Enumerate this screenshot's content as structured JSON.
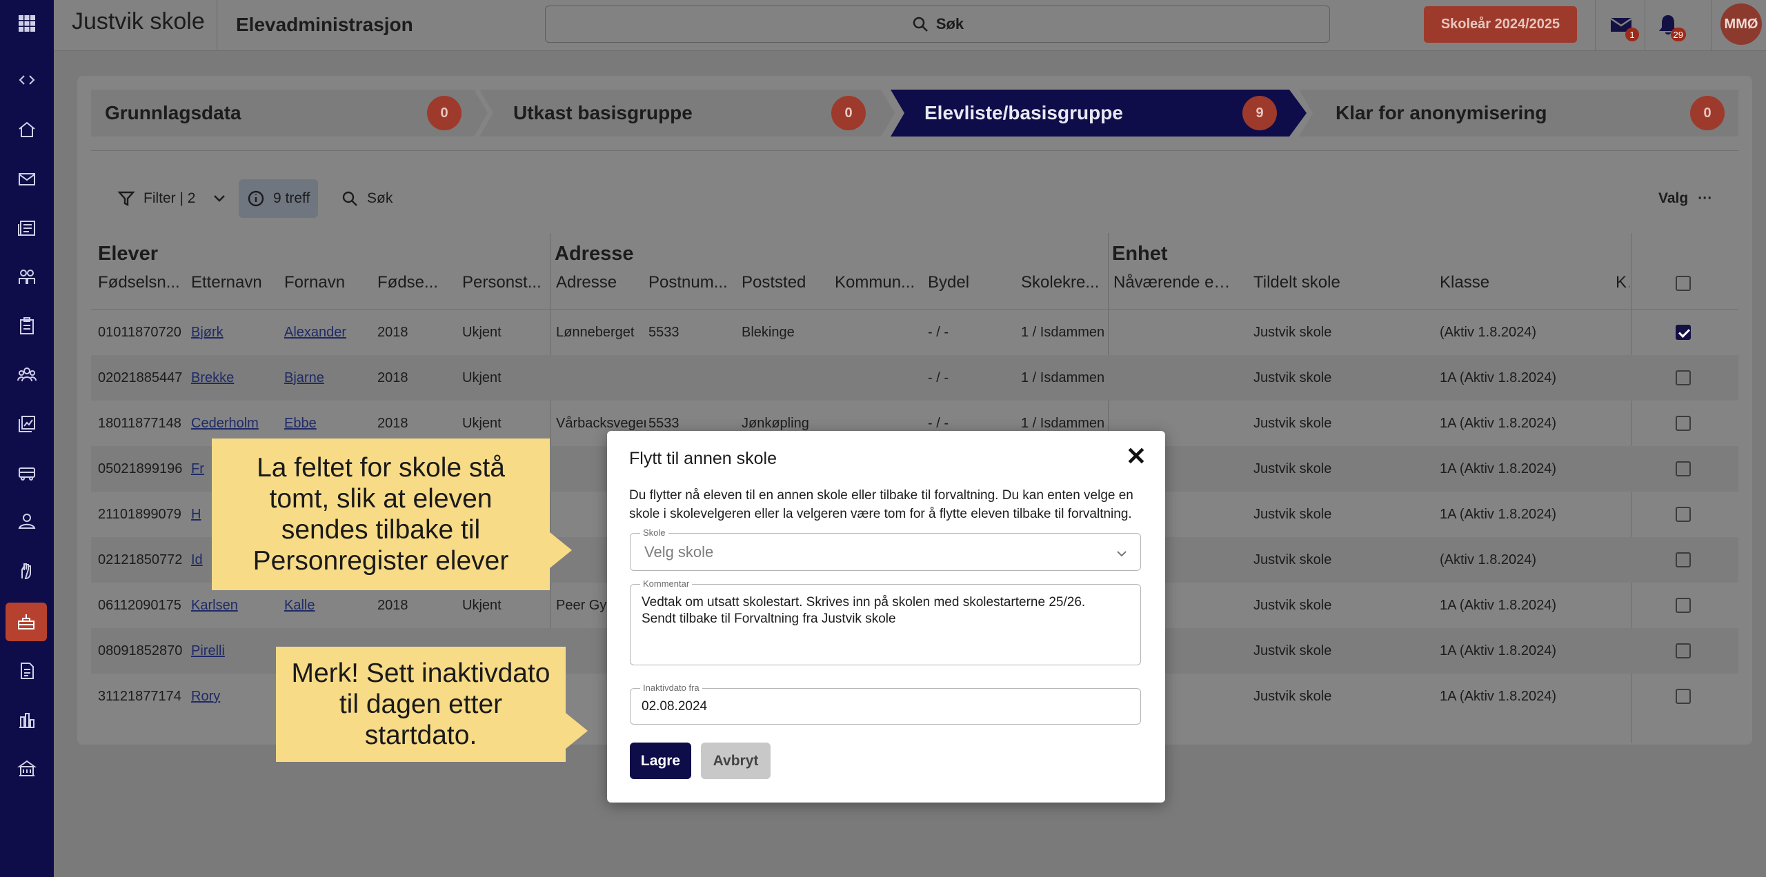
{
  "topbar": {
    "school_name": "Justvik skole",
    "app_title": "Elevadministrasjon",
    "search_label": "Søk",
    "year_button": "Skoleår 2024/2025",
    "mail_badge": "1",
    "bell_badge": "29",
    "avatar_initials": "MMØ"
  },
  "rail": {
    "items": [
      "grid-icon",
      "expand-icon",
      "home-icon",
      "mail-icon",
      "newspaper-icon",
      "people-icon",
      "clipboard-icon",
      "group-icon",
      "chart-card-icon",
      "vehicle-icon",
      "person-icon",
      "hand-icon",
      "school-icon",
      "document-icon",
      "bar-chart-icon",
      "building-icon"
    ],
    "active_color": "#b6412f"
  },
  "stepper": {
    "steps": [
      {
        "label": "Grunnlagsdata",
        "count": "0"
      },
      {
        "label": "Utkast basisgruppe",
        "count": "0"
      },
      {
        "label": "Elevliste/basisgruppe",
        "count": "9"
      },
      {
        "label": "Klar for anonymisering",
        "count": "0"
      }
    ],
    "active_step": 2,
    "active_color": "#0f0c4a"
  },
  "toolbar": {
    "filter_label": "Filter | 2",
    "hits_label": "9 treff",
    "search_label": "Søk",
    "options_label": "Valg",
    "more_label": "···"
  },
  "table": {
    "groups": [
      "Elever",
      "Adresse",
      "Enhet"
    ],
    "headers": [
      "Fødselsn...",
      "Etternavn",
      "Fornavn",
      "Fødse...",
      "Personst...",
      "Adresse",
      "Postnum...",
      "Poststed",
      "Kommun...",
      "Bydel",
      "Skolekre...",
      "Nåværende en...",
      "Tildelt skole",
      "Klasse",
      "Ko"
    ],
    "rows": [
      {
        "fnr": "01011870720",
        "etternavn": "Bjørk",
        "fornavn": "Alexander",
        "aar": "2018",
        "status": "Ukjent",
        "adresse": "Lønneberget",
        "postnr": "5533",
        "poststed": "Blekinge",
        "kommune": "",
        "bydel": "- / -",
        "krets": "1 / Isdammen",
        "naavaerende": "",
        "tildelt": "Justvik skole",
        "klasse": "(Aktiv 1.8.2024)",
        "checked": true
      },
      {
        "fnr": "02021885447",
        "etternavn": "Brekke",
        "fornavn": "Bjarne",
        "aar": "2018",
        "status": "Ukjent",
        "adresse": "",
        "postnr": "",
        "poststed": "",
        "kommune": "",
        "bydel": "- / -",
        "krets": "1 / Isdammen",
        "naavaerende": "",
        "tildelt": "Justvik skole",
        "klasse": "1A (Aktiv 1.8.2024)",
        "checked": false
      },
      {
        "fnr": "18011877148",
        "etternavn": "Cederholm",
        "fornavn": "Ebbe",
        "aar": "2018",
        "status": "Ukjent",
        "adresse": "Vårbacksvegen",
        "postnr": "5533",
        "poststed": "Jønkøpling",
        "kommune": "",
        "bydel": "- / -",
        "krets": "1 / Isdammen",
        "naavaerende": "",
        "tildelt": "Justvik skole",
        "klasse": "1A (Aktiv 1.8.2024)",
        "checked": false
      },
      {
        "fnr": "05021899196",
        "etternavn": "Fr",
        "fornavn": "",
        "aar": "",
        "status": "",
        "adresse": "",
        "postnr": "",
        "poststed": "",
        "kommune": "",
        "bydel": "",
        "krets": "",
        "naavaerende": "",
        "tildelt": "Justvik skole",
        "klasse": "1A (Aktiv 1.8.2024)",
        "checked": false
      },
      {
        "fnr": "21101899079",
        "etternavn": "H",
        "fornavn": "",
        "aar": "",
        "status": "",
        "adresse": "",
        "postnr": "",
        "poststed": "",
        "kommune": "",
        "bydel": "",
        "krets": "",
        "naavaerende": "",
        "tildelt": "Justvik skole",
        "klasse": "1A (Aktiv 1.8.2024)",
        "checked": false
      },
      {
        "fnr": "02121850772",
        "etternavn": "Id",
        "fornavn": "",
        "aar": "",
        "status": "",
        "adresse": "",
        "postnr": "",
        "poststed": "",
        "kommune": "",
        "bydel": "",
        "krets": "",
        "naavaerende": "",
        "tildelt": "Justvik skole",
        "klasse": "(Aktiv 1.8.2024)",
        "checked": false
      },
      {
        "fnr": "06112090175",
        "etternavn": "Karlsen",
        "fornavn": "Kalle",
        "aar": "2018",
        "status": "Ukjent",
        "adresse": "Peer Gyn",
        "postnr": "",
        "poststed": "",
        "kommune": "",
        "bydel": "",
        "krets": "",
        "naavaerende": "",
        "tildelt": "Justvik skole",
        "klasse": "1A (Aktiv 1.8.2024)",
        "checked": false
      },
      {
        "fnr": "08091852870",
        "etternavn": "Pirelli",
        "fornavn": "",
        "aar": "",
        "status": "",
        "adresse": "",
        "postnr": "",
        "poststed": "",
        "kommune": "",
        "bydel": "",
        "krets": "",
        "naavaerende": "",
        "tildelt": "Justvik skole",
        "klasse": "1A (Aktiv 1.8.2024)",
        "checked": false
      },
      {
        "fnr": "31121877174",
        "etternavn": "Rory",
        "fornavn": "",
        "aar": "",
        "status": "",
        "adresse": "",
        "postnr": "",
        "poststed": "",
        "kommune": "",
        "bydel": "",
        "krets": "",
        "naavaerende": "",
        "tildelt": "Justvik skole",
        "klasse": "1A (Aktiv 1.8.2024)",
        "checked": false
      }
    ]
  },
  "callouts": {
    "school_hint": "La feltet for skole stå tomt, slik at eleven sendes tilbake til Personregister elever",
    "date_hint": "Merk! Sett inaktivdato til dagen etter startdato."
  },
  "modal": {
    "title": "Flytt til annen skole",
    "close": "✕",
    "description": "Du flytter nå eleven til en annen skole eller tilbake til forvaltning. Du kan enten velge en skole i skolevelgeren eller la velgeren være tom for å flytte eleven tilbake til forvaltning.",
    "skole_legend": "Skole",
    "skole_placeholder": "Velg skole",
    "kommentar_legend": "Kommentar",
    "kommentar_value": "Vedtak om utsatt skolestart. Skrives inn på skolen med skolestarterne 25/26.\nSendt tilbake til Forvaltning fra Justvik skole",
    "dato_legend": "Inaktivdato fra",
    "dato_value": "02.08.2024",
    "save_label": "Lagre",
    "cancel_label": "Avbryt"
  }
}
